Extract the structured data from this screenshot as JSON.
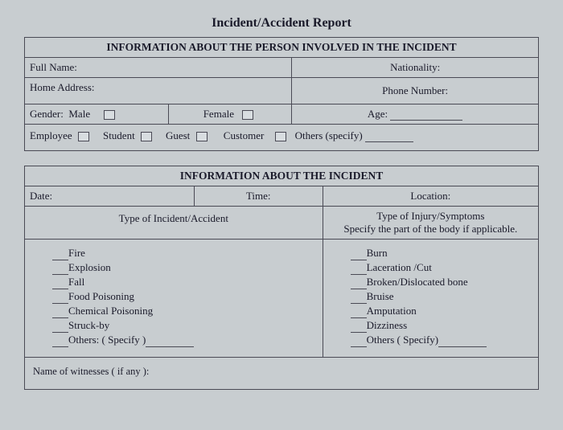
{
  "title": "Incident/Accident Report",
  "section1": {
    "header": "INFORMATION ABOUT THE PERSON INVOLVED IN THE INCIDENT",
    "full_name_label": "Full Name:",
    "nationality_label": "Nationality:",
    "home_address_label": "Home Address:",
    "phone_label": "Phone Number:",
    "gender_label": "Gender:",
    "male_label": "Male",
    "female_label": "Female",
    "age_label": "Age:",
    "role": {
      "employee": "Employee",
      "student": "Student",
      "guest": "Guest",
      "customer": "Customer",
      "others": "Others (specify)"
    }
  },
  "section2": {
    "header": "INFORMATION ABOUT THE INCIDENT",
    "date_label": "Date:",
    "time_label": "Time:",
    "location_label": "Location:",
    "type_incident_header": "Type of Incident/Accident",
    "type_injury_header": "Type of Injury/Symptoms",
    "type_injury_sub": "Specify the part of the body if applicable.",
    "incident_types": [
      "Fire",
      "Explosion",
      "Fall",
      "Food Poisoning",
      "Chemical Poisoning",
      "Struck-by",
      "Others: ( Specify )"
    ],
    "injury_types": [
      "Burn",
      "Laceration /Cut",
      "Broken/Dislocated bone",
      "Bruise",
      "Amputation",
      "Dizziness",
      "Others ( Specify)"
    ],
    "witness_label": "Name of witnesses ( if any ):"
  }
}
